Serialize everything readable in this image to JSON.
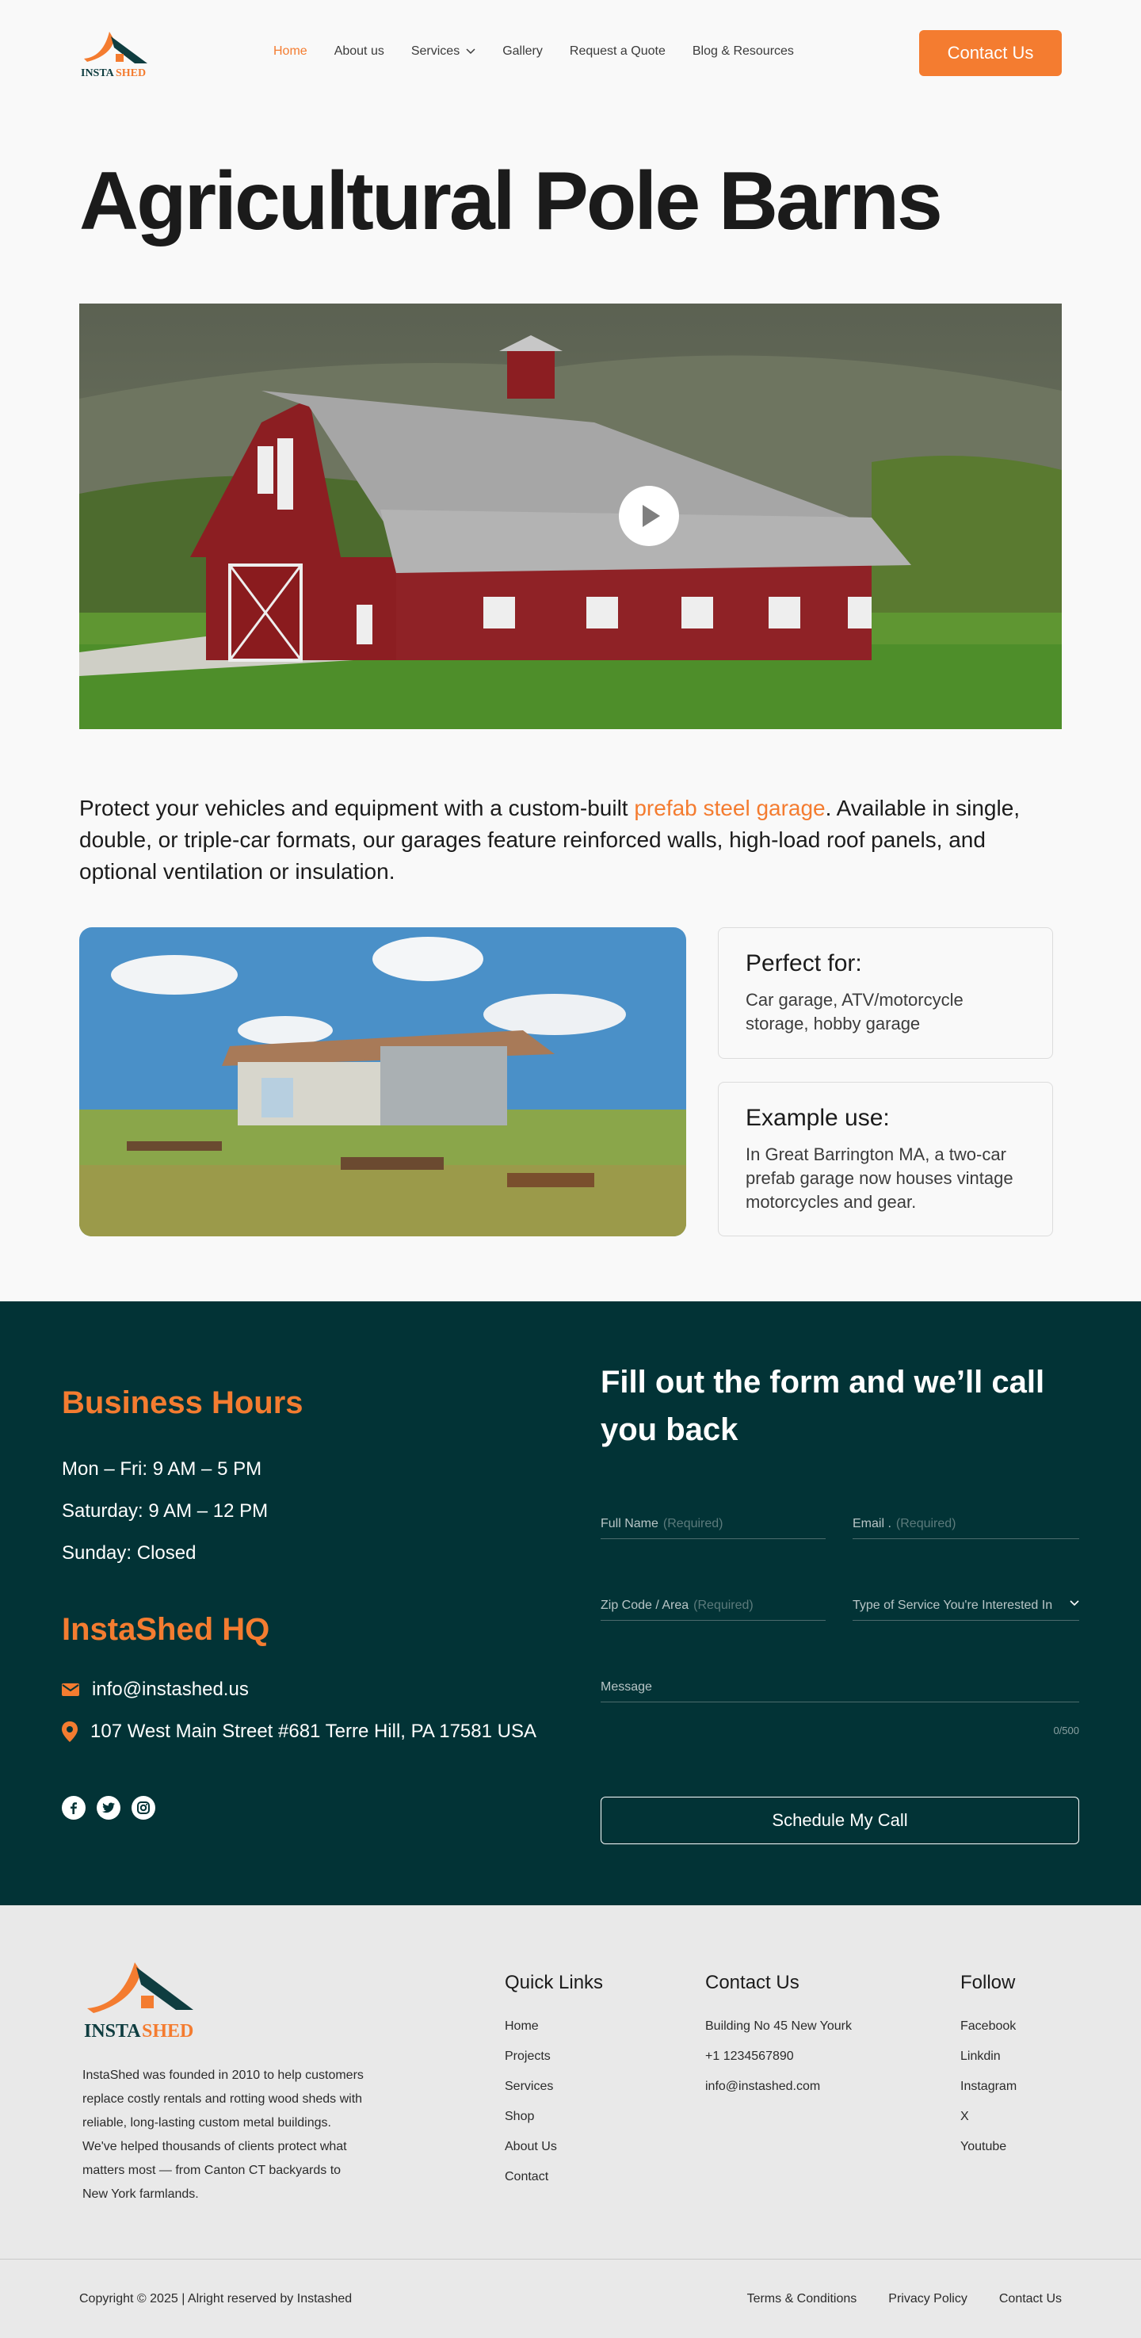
{
  "brand": {
    "name_part1": "INSTA",
    "name_part2": "SHED",
    "accent": "#f47c30",
    "dark": "#023336"
  },
  "nav": {
    "items": [
      {
        "label": "Home",
        "active": true
      },
      {
        "label": "About us"
      },
      {
        "label": "Services",
        "dropdown": true
      },
      {
        "label": "Gallery"
      },
      {
        "label": "Request a Quote"
      },
      {
        "label": "Blog & Resources"
      }
    ],
    "cta": "Contact Us"
  },
  "hero": {
    "title": "Agricultural Pole Barns"
  },
  "intro": {
    "before": "Protect your vehicles and equipment with a custom-built ",
    "link": "prefab steel garage",
    "after": ". Available in single, double, or triple-car formats, our garages feature reinforced walls, high-load roof panels, and optional ventilation or insulation."
  },
  "cards": [
    {
      "title": "Perfect for:",
      "text": "Car garage, ATV/motorcycle storage, hobby garage"
    },
    {
      "title": "Example use:",
      "text": "In Great Barrington MA, a two-car prefab garage now houses vintage motorcycles and gear."
    }
  ],
  "contact": {
    "hours_title": "Business Hours",
    "hours": [
      "Mon – Fri: 9 AM – 5 PM",
      "Saturday: 9 AM – 12 PM",
      "Sunday: Closed"
    ],
    "hq_title": "InstaShed HQ",
    "email": "info@instashed.us",
    "address": "107 West Main Street #681 Terre Hill, PA 17581 USA",
    "socials": [
      "facebook-icon",
      "twitter-icon",
      "instagram-icon"
    ],
    "form_title": "Fill out the form and we’ll call you back",
    "fields": {
      "name": "Full Name",
      "email": "Email .",
      "zip": "Zip Code / Area",
      "type": "Type of Service You're Interested In",
      "message": "Message",
      "required": "(Required)",
      "counter": "0/500"
    },
    "submit": "Schedule My Call"
  },
  "footer": {
    "about": "InstaShed was founded in 2010 to help customers replace costly rentals and rotting wood sheds with reliable, long-lasting custom metal buildings. We've helped thousands of clients protect what matters most — from Canton CT backyards to New York farmlands.",
    "quick_links_title": "Quick Links",
    "quick_links": [
      "Home",
      "Projects",
      "Services",
      "Shop",
      "About Us",
      "Contact"
    ],
    "contact_title": "Contact Us",
    "contact_items": [
      "Building No 45 New Yourk",
      "+1 1234567890",
      "info@instashed.com"
    ],
    "follow_title": "Follow",
    "follow": [
      "Facebook",
      "Linkdin",
      "Instagram",
      "X",
      "Youtube"
    ],
    "copyright": "Copyright © 2025 | Alright reserved by  Instashed",
    "legal": [
      "Terms & Conditions",
      "Privacy Policy",
      "Contact Us"
    ]
  }
}
